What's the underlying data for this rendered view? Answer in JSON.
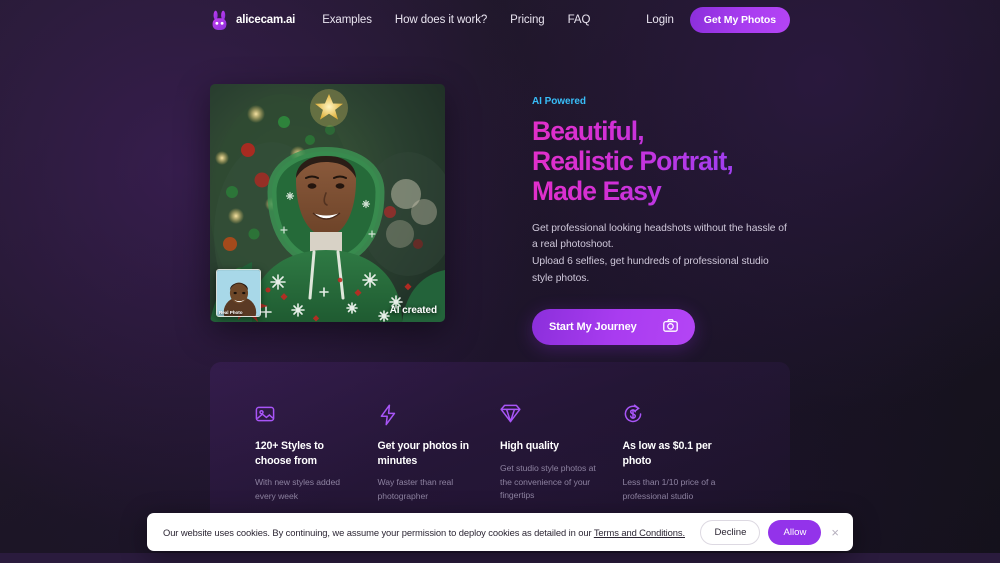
{
  "navbar": {
    "brand_name": "alicecam.ai",
    "brand_icon": "rabbit-logo-icon",
    "links": [
      {
        "label": "Examples"
      },
      {
        "label": "How does it work?"
      },
      {
        "label": "Pricing"
      },
      {
        "label": "FAQ"
      }
    ],
    "login_label": "Login",
    "cta_label": "Get My Photos",
    "cta_color": "#a93cf0"
  },
  "hero": {
    "eyebrow": "AI Powered",
    "eyebrow_color": "#38bdf8",
    "headline_lines": [
      "Beautiful,",
      "Realistic Portrait,",
      "Made Easy"
    ],
    "headline_gradient_from": "#e22fc9",
    "headline_gradient_to": "#8f44ef",
    "subcopy_line1": "Get professional looking headshots without the hassle of a real photoshoot.",
    "subcopy_line2": "Upload 6 selfies, get hundreds of professional studio style photos.",
    "cta_label": "Start My Journey",
    "cta_icon": "camera-icon",
    "media": {
      "ai_label": "AI created",
      "thumb_label": "Real Photo",
      "alt": "portrait-of-smiling-man-in-green-christmas-hoodie"
    }
  },
  "features": [
    {
      "icon": "image-icon",
      "title": "120+ Styles to choose from",
      "desc": "With new styles added every week"
    },
    {
      "icon": "lightning-bolt-icon",
      "title": "Get your photos in minutes",
      "desc": "Way faster than real photographer"
    },
    {
      "icon": "diamond-icon",
      "title": "High quality",
      "desc": "Get studio style photos at the convenience of your fingertips"
    },
    {
      "icon": "dollar-refresh-icon",
      "title": "As low as $0.1 per photo",
      "desc": "Less than 1/10 price of a professional studio"
    }
  ],
  "cookie_banner": {
    "text_before": "Our website uses cookies. By continuing, we assume your permission to deploy cookies as detailed in our ",
    "terms_label": "Terms and Conditions.",
    "decline_label": "Decline",
    "allow_label": "Allow",
    "allow_color": "#9333ea",
    "close_icon": "close-icon",
    "close_glyph": "×"
  }
}
